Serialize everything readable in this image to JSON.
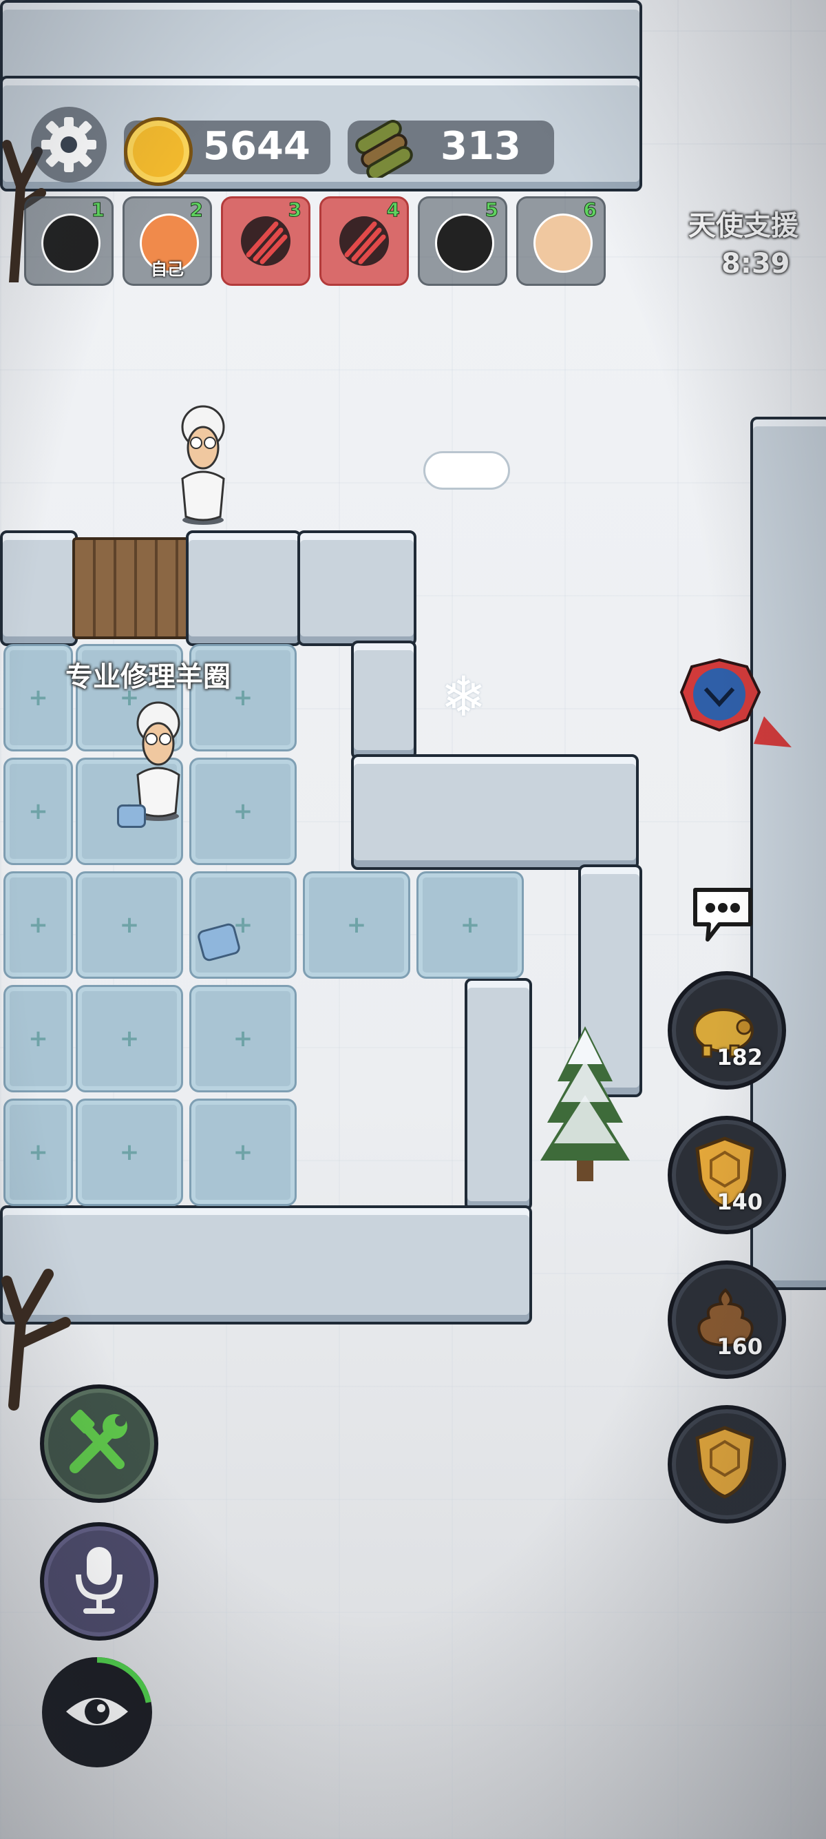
{
  "resources": {
    "gold": "5644",
    "wood": "313"
  },
  "players": [
    {
      "number": "1",
      "self_label": ""
    },
    {
      "number": "2",
      "self_label": "自己"
    },
    {
      "number": "3",
      "self_label": ""
    },
    {
      "number": "4",
      "self_label": ""
    },
    {
      "number": "5",
      "self_label": ""
    },
    {
      "number": "6",
      "self_label": ""
    }
  ],
  "event": {
    "title": "天使支援",
    "timer": "8:39"
  },
  "map": {
    "pen_label": "专业修理羊圈"
  },
  "right_buttons": {
    "pig_count": "182",
    "shield_count": "140",
    "poop_count": "160"
  },
  "progress": {
    "eye_ring_fraction": 0.22
  },
  "colors": {
    "danger_slot": "#d96b6b",
    "count_green": "#5fd35f",
    "wrench_button": "#3f5248",
    "mic_button": "#4c4a6a"
  }
}
